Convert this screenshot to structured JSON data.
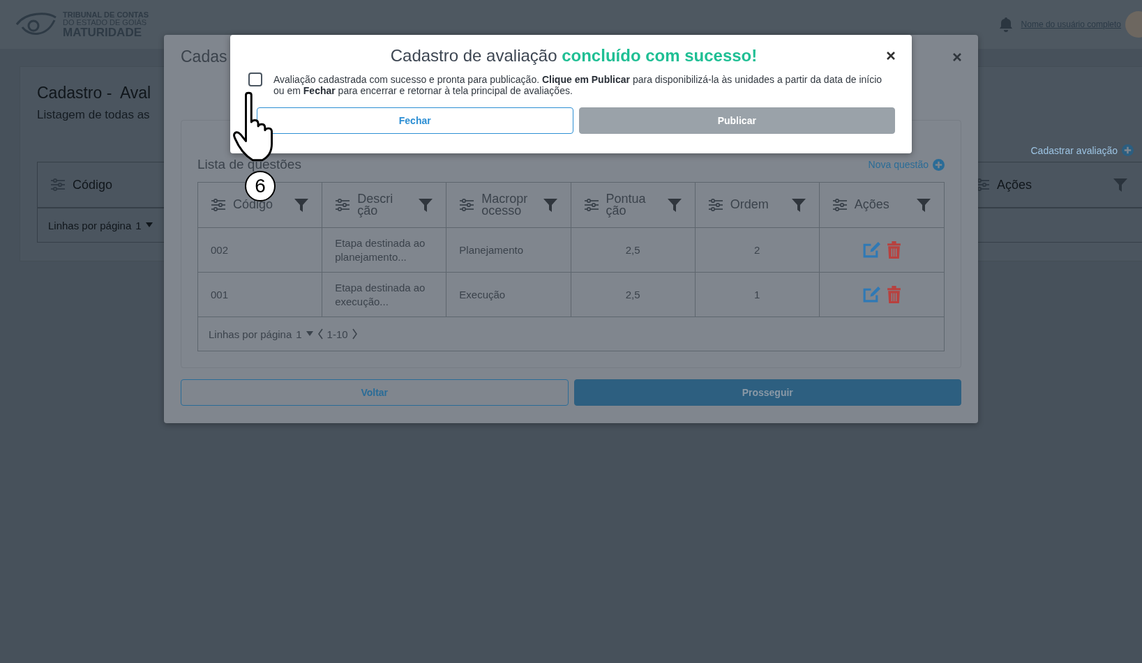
{
  "header": {
    "logo_lines": [
      "TRIBUNAL DE CONTAS",
      "DO ESTADO DE GOIÁS",
      "MATURIDADE"
    ],
    "user_name": "Nome do usuário completo"
  },
  "page": {
    "title": "Cadastro -  Aval",
    "subtitle": "Listagem de todas as",
    "add_link": "Cadastrar avaliação",
    "table": {
      "columns": [
        "Código",
        "Ações"
      ],
      "footer": {
        "rows_label": "Linhas por  página",
        "page_size": "1"
      }
    }
  },
  "modal": {
    "title": "Cadas",
    "list_title": "Lista de questões",
    "add_link": "Nova questão",
    "table": {
      "columns": [
        {
          "lines": [
            "Código"
          ]
        },
        {
          "lines": [
            "Descri",
            "ção"
          ]
        },
        {
          "lines": [
            "Macropr",
            "ocesso"
          ]
        },
        {
          "lines": [
            "Pontua",
            "ção"
          ]
        },
        {
          "lines": [
            "Ordem"
          ]
        },
        {
          "lines": [
            "Ações"
          ]
        }
      ],
      "rows": [
        {
          "code": "002",
          "description": "Etapa destinada ao planejamento...",
          "macroprocess": "Planejamento",
          "score": "2,5",
          "order": "2"
        },
        {
          "code": "001",
          "description": "Etapa destinada ao execução...",
          "macroprocess": "Execução",
          "score": "2,5",
          "order": "1"
        }
      ],
      "footer": {
        "rows_label": "Linhas por  página",
        "page_size": "1",
        "range": "1-10"
      }
    },
    "buttons": [
      {
        "label": "Voltar",
        "kind": "outline"
      },
      {
        "label": "Prosseguir",
        "kind": "primary"
      }
    ]
  },
  "dialog": {
    "title": "Cadastro de avaliação",
    "title_highlight": "concluído com sucesso!",
    "checkbox": {
      "checked": false
    },
    "message": "Avaliação cadastrada com sucesso e pronta para publicação. **Clique em Publicar** para disponibilizá-la às unidades a partir da data de início ou em **Fechar** para encerrar e retornar à tela principal de avaliações.",
    "buttons": [
      {
        "label": "Fechar",
        "kind": "outline",
        "disabled": false
      },
      {
        "label": "Publicar",
        "kind": "primary",
        "disabled": true
      }
    ]
  },
  "tutorial": {
    "step": "6"
  }
}
